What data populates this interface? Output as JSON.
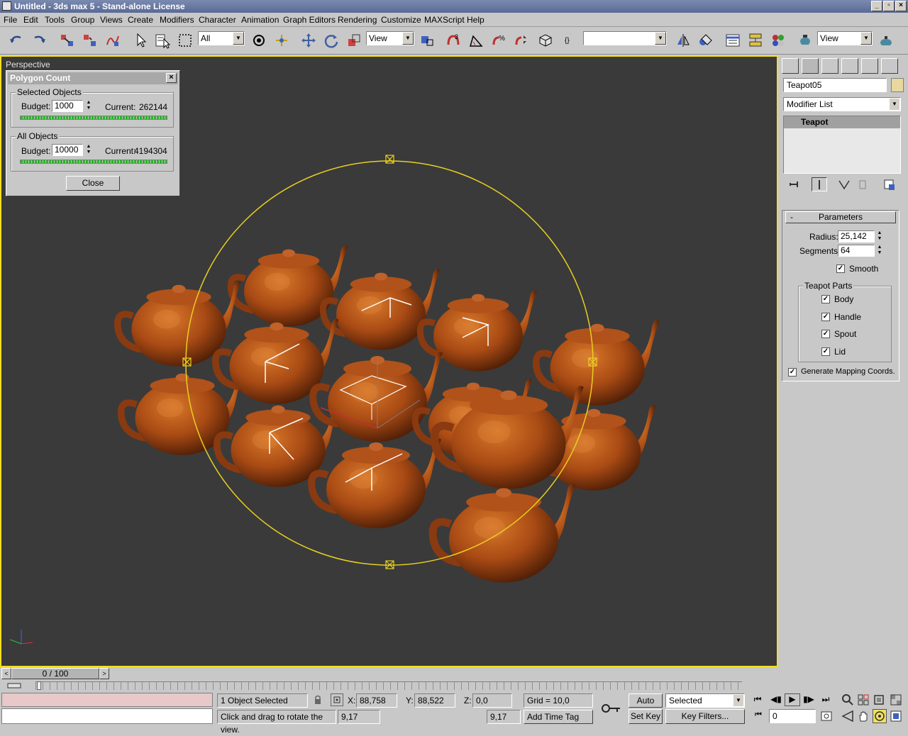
{
  "window": {
    "title": "Untitled - 3ds max 5 - Stand-alone License"
  },
  "menu": [
    "File",
    "Edit",
    "Tools",
    "Group",
    "Views",
    "Create",
    "Modifiers",
    "Character",
    "Animation",
    "Graph Editors",
    "Rendering",
    "Customize",
    "MAXScript",
    "Help"
  ],
  "toolbar": {
    "selection_filter": "All",
    "ref_coord": "View",
    "named_selection": "",
    "render_type": "View"
  },
  "viewport": {
    "label": "Perspective"
  },
  "polygon_count": {
    "title": "Polygon Count",
    "selected_group": "Selected Objects",
    "all_group": "All Objects",
    "budget_label": "Budget:",
    "current_label": "Current:",
    "selected_budget": "1000",
    "selected_current": "262144",
    "all_budget": "10000",
    "all_current": "4194304",
    "close_label": "Close"
  },
  "command_panel": {
    "object_name": "Teapot05",
    "object_color": "#e8d8a0",
    "modifier_list": "Modifier List",
    "stack_item": "Teapot",
    "rollout_title": "Parameters",
    "rollout_toggle": "-",
    "radius_label": "Radius:",
    "radius_value": "25,142",
    "segments_label": "Segments:",
    "segments_value": "64",
    "smooth_label": "Smooth",
    "parts_group": "Teapot Parts",
    "parts": [
      "Body",
      "Handle",
      "Spout",
      "Lid"
    ],
    "gen_mapping_label": "Generate Mapping Coords."
  },
  "timeline": {
    "frame_display": "0 / 100"
  },
  "status": {
    "selection": "1 Object Selected",
    "prompt": "Click and drag to rotate the view.",
    "x_label": "X:",
    "x_value": "88,758",
    "y_label": "Y:",
    "y_value": "88,522",
    "z_label": "Z:",
    "z_value": "0,0",
    "grid": "Grid = 10,0",
    "add_time_tag": "Add Time Tag",
    "auto_key": "Auto Key",
    "set_key": "Set Key",
    "key_mode": "Selected",
    "key_filters": "Key Filters...",
    "frame_value": "0",
    "coord_left": "9,17",
    "coord_right": "9,17"
  }
}
